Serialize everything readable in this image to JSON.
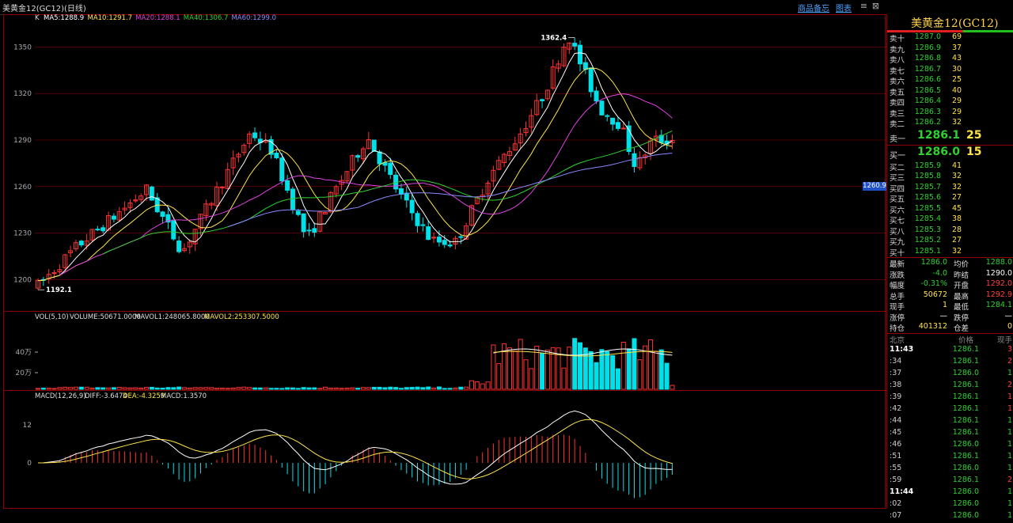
{
  "window": {
    "title": "美黄金12(GC12)(日线)",
    "link1": "商品备忘",
    "link2": "图表"
  },
  "main": {
    "k_label": "K",
    "ma": [
      {
        "label": "MA5:1288.9",
        "color": "#ffffff"
      },
      {
        "label": "MA10:1291.7",
        "color": "#ffe34a"
      },
      {
        "label": "MA20:1288.1",
        "color": "#e040e0"
      },
      {
        "label": "MA40:1306.7",
        "color": "#30d030"
      },
      {
        "label": "MA60:1299.0",
        "color": "#8a8aff"
      }
    ],
    "y_ticks": [
      "1350",
      "1320",
      "1290",
      "1260",
      "1230",
      "1200"
    ],
    "y_ticks_val": [
      1350,
      1320,
      1290,
      1260,
      1230,
      1200
    ],
    "high_mark": "1362.4",
    "low_mark": "1192.1",
    "price_tag": "1260.9",
    "price_range": [
      1190,
      1365
    ]
  },
  "vol": {
    "label": "VOL(5,10)",
    "volume": "VOLUME:50671.0000",
    "mavol1": "MAVOL1:248065.8000",
    "mavol2": "MAVOL2:253307.5000",
    "y_ticks": [
      "40万",
      "20万"
    ]
  },
  "macd": {
    "label": "MACD(12,26,9)",
    "diff": "DIFF:-3.6474",
    "dea": "DEA:-4.3259",
    "macd": "MACD:1.3570",
    "y_ticks": [
      "12",
      "0"
    ]
  },
  "quote": {
    "name": "美黄金12(GC12)",
    "asks": [
      {
        "label": "卖十",
        "price": "1287.0",
        "vol": "69"
      },
      {
        "label": "卖九",
        "price": "1286.9",
        "vol": "37"
      },
      {
        "label": "卖八",
        "price": "1286.8",
        "vol": "43"
      },
      {
        "label": "卖七",
        "price": "1286.7",
        "vol": "30"
      },
      {
        "label": "卖六",
        "price": "1286.6",
        "vol": "25"
      },
      {
        "label": "卖五",
        "price": "1286.5",
        "vol": "40"
      },
      {
        "label": "卖四",
        "price": "1286.4",
        "vol": "29"
      },
      {
        "label": "卖三",
        "price": "1286.3",
        "vol": "29"
      },
      {
        "label": "卖二",
        "price": "1286.2",
        "vol": "32"
      }
    ],
    "ask1": {
      "label": "卖一",
      "price": "1286.1",
      "vol": "25"
    },
    "bid1": {
      "label": "买一",
      "price": "1286.0",
      "vol": "15"
    },
    "bids": [
      {
        "label": "买二",
        "price": "1285.9",
        "vol": "41"
      },
      {
        "label": "买三",
        "price": "1285.8",
        "vol": "32"
      },
      {
        "label": "买四",
        "price": "1285.7",
        "vol": "32"
      },
      {
        "label": "买五",
        "price": "1285.6",
        "vol": "27"
      },
      {
        "label": "买六",
        "price": "1285.5",
        "vol": "45"
      },
      {
        "label": "买七",
        "price": "1285.4",
        "vol": "38"
      },
      {
        "label": "买八",
        "price": "1285.3",
        "vol": "28"
      },
      {
        "label": "买九",
        "price": "1285.2",
        "vol": "27"
      },
      {
        "label": "买十",
        "price": "1285.1",
        "vol": "32"
      }
    ],
    "stats": [
      {
        "a": "最新",
        "b": "1286.0",
        "bc": "grn",
        "c": "均价",
        "d": "1288.0",
        "dc": "grn"
      },
      {
        "a": "涨跌",
        "b": "-4.0",
        "bc": "grn",
        "c": "昨结",
        "d": "1290.0",
        "dc": "wht"
      },
      {
        "a": "幅度",
        "b": "-0.31%",
        "bc": "grn",
        "c": "开盘",
        "d": "1292.0",
        "dc": "red"
      },
      {
        "a": "总手",
        "b": "50672",
        "bc": "yel",
        "c": "最高",
        "d": "1292.9",
        "dc": "red"
      },
      {
        "a": "现手",
        "b": "1",
        "bc": "yel",
        "c": "最低",
        "d": "1284.1",
        "dc": "grn"
      },
      {
        "a": "涨停",
        "b": "—",
        "bc": "wht",
        "c": "跌停",
        "d": "—",
        "dc": "wht"
      },
      {
        "a": "持仓",
        "b": "401312",
        "bc": "yel",
        "c": "仓差",
        "d": "0",
        "dc": "yel"
      }
    ],
    "ticks_head": {
      "time": "北京",
      "price": "价格",
      "vol": "现手"
    },
    "ticks": [
      {
        "t": "11:43",
        "s": true,
        "p": "1286.1",
        "v": "3",
        "vc": "red"
      },
      {
        "t": ":34",
        "s": false,
        "p": "1286.1",
        "v": "2",
        "vc": "red"
      },
      {
        "t": ":37",
        "s": false,
        "p": "1286.0",
        "v": "1",
        "vc": "grn"
      },
      {
        "t": ":38",
        "s": false,
        "p": "1286.1",
        "v": "2",
        "vc": "red"
      },
      {
        "t": ":39",
        "s": false,
        "p": "1286.1",
        "v": "1",
        "vc": "red"
      },
      {
        "t": ":42",
        "s": false,
        "p": "1286.1",
        "v": "1",
        "vc": "red"
      },
      {
        "t": ":44",
        "s": false,
        "p": "1286.1",
        "v": "1",
        "vc": "grn"
      },
      {
        "t": ":45",
        "s": false,
        "p": "1286.1",
        "v": "1",
        "vc": "grn"
      },
      {
        "t": ":46",
        "s": false,
        "p": "1286.0",
        "v": "1",
        "vc": "grn"
      },
      {
        "t": ":51",
        "s": false,
        "p": "1286.1",
        "v": "1",
        "vc": "grn"
      },
      {
        "t": ":55",
        "s": false,
        "p": "1286.0",
        "v": "1",
        "vc": "grn"
      },
      {
        "t": ":59",
        "s": false,
        "p": "1286.1",
        "v": "2",
        "vc": "red"
      },
      {
        "t": "11:44",
        "s": true,
        "p": "1286.0",
        "v": "1",
        "vc": "grn"
      },
      {
        "t": ":02",
        "s": false,
        "p": "1286.0",
        "v": "1",
        "vc": "grn"
      },
      {
        "t": ":07",
        "s": false,
        "p": "1286.0",
        "v": "1",
        "vc": "grn"
      }
    ]
  },
  "colors": {
    "up": "#ff3232",
    "down": "#00e0e8",
    "grid": "#8b0000",
    "axis": "#aaaaaa"
  }
}
